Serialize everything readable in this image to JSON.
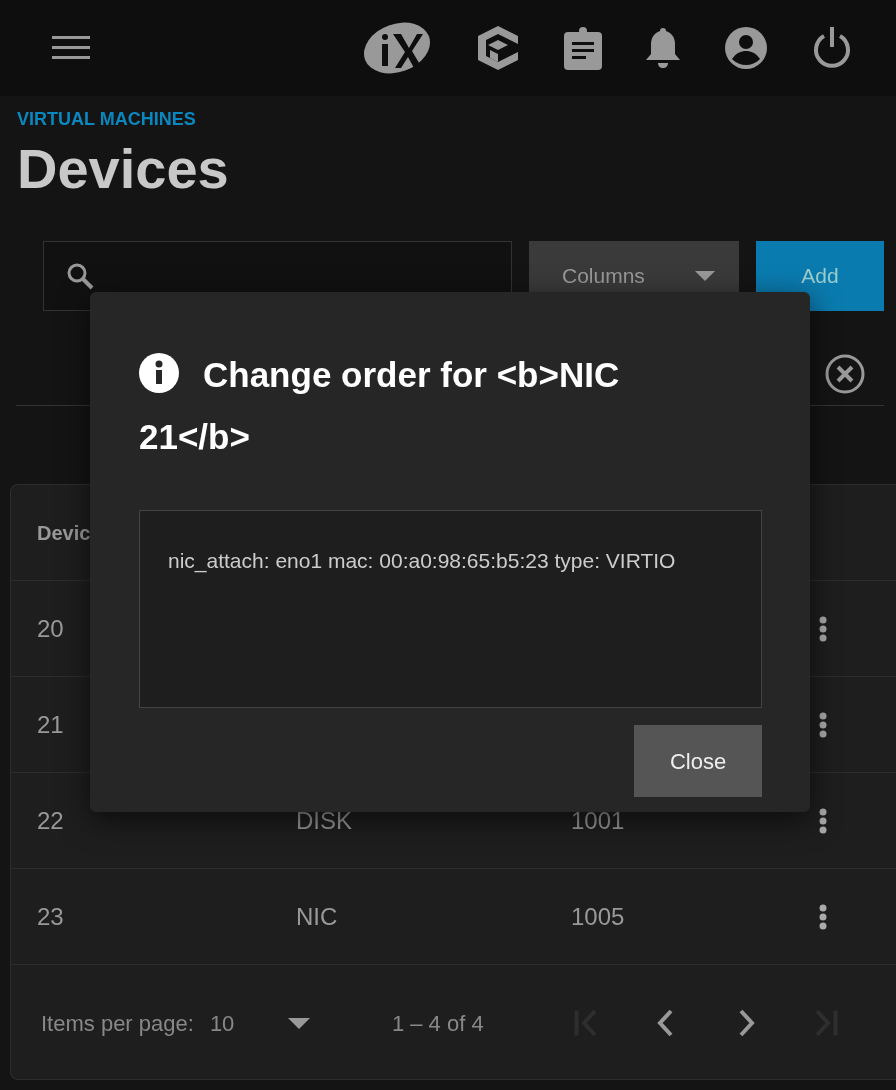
{
  "breadcrumb": "VIRTUAL MACHINES",
  "page_title": "Devices",
  "toolbar": {
    "columns_button": "Columns",
    "add_button": "Add"
  },
  "table": {
    "header_visible": "Devic",
    "rows": [
      {
        "cells": [
          "20"
        ]
      },
      {
        "cells": [
          "21"
        ]
      },
      {
        "cells": [
          "22",
          "DISK",
          "1001"
        ]
      },
      {
        "cells": [
          "23",
          "NIC",
          "1005"
        ]
      }
    ]
  },
  "paginator": {
    "label": "Items per page:",
    "page_size": "10",
    "range": "1 – 4 of 4",
    "buttons": [
      {
        "kind": "first",
        "disabled": true
      },
      {
        "kind": "prev",
        "disabled": false
      },
      {
        "kind": "next",
        "disabled": false
      },
      {
        "kind": "last",
        "disabled": true
      }
    ]
  },
  "dialog": {
    "title": "Change order for <b>NIC 21</b>",
    "body": "nic_attach: eno1 mac: 00:a0:98:65:b5:23 type: VIRTIO",
    "close_button": "Close"
  }
}
